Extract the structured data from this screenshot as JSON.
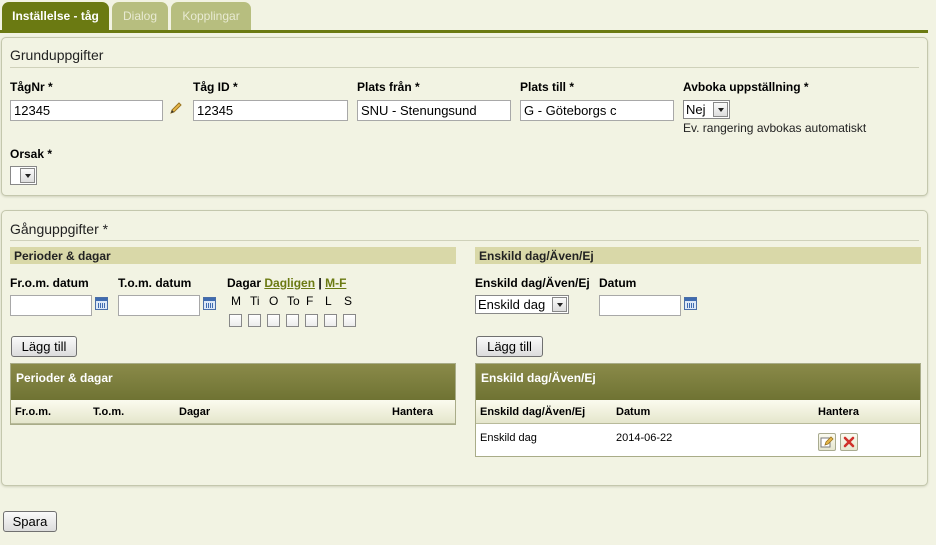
{
  "tabs": [
    {
      "label": "Inställelse - tåg",
      "active": true
    },
    {
      "label": "Dialog",
      "active": false
    },
    {
      "label": "Kopplingar",
      "active": false
    }
  ],
  "basic": {
    "title": "Grunduppgifter",
    "fields": {
      "tagnr": {
        "label": "TågNr *",
        "value": "12345"
      },
      "tag_id": {
        "label": "Tåg ID *",
        "value": "12345"
      },
      "plats_fran": {
        "label": "Plats från *",
        "value": "SNU - Stenungsund"
      },
      "plats_till": {
        "label": "Plats till *",
        "value": "G - Göteborgs c"
      },
      "avboka": {
        "label": "Avboka uppställning *",
        "value": "Nej",
        "hint": "Ev. rangering avbokas automatiskt"
      },
      "orsak": {
        "label": "Orsak *",
        "value": ""
      }
    }
  },
  "running": {
    "title": "Gånguppgifter *",
    "periods": {
      "header": "Perioder & dagar",
      "from_label": "Fr.o.m. datum",
      "to_label": "T.o.m. datum",
      "days_label": "Dagar",
      "link_daily": "Dagligen",
      "separator": "|",
      "link_weekdays": "M-F",
      "day_letters": [
        "M",
        "Ti",
        "O",
        "To",
        "F",
        "L",
        "S"
      ],
      "add_button": "Lägg till",
      "table": {
        "title": "Perioder & dagar",
        "columns": [
          "Fr.o.m.",
          "T.o.m.",
          "Dagar",
          "Hantera"
        ],
        "rows": []
      }
    },
    "single": {
      "header": "Enskild dag/Även/Ej",
      "type_label": "Enskild dag/Även/Ej",
      "type_value": "Enskild dag",
      "date_label": "Datum",
      "add_button": "Lägg till",
      "table": {
        "title": "Enskild dag/Även/Ej",
        "columns": [
          "Enskild dag/Även/Ej",
          "Datum",
          "Hantera"
        ],
        "rows": [
          {
            "type": "Enskild dag",
            "date": "2014-06-22"
          }
        ]
      }
    }
  },
  "save_button": "Spara",
  "colors": {
    "accent": "#6b7a12",
    "background": "#f2f3e3",
    "section_header": "#d9d8a8"
  }
}
